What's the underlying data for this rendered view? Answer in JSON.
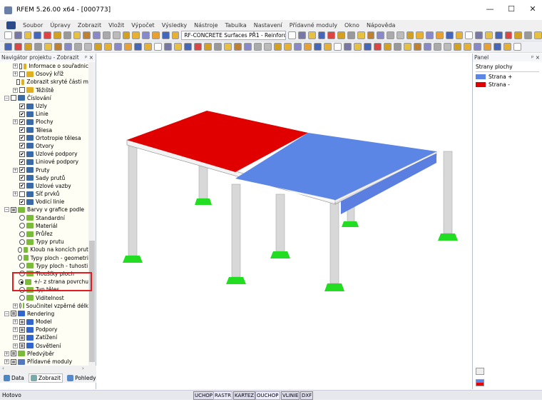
{
  "window": {
    "title": "RFEM 5.26.00 x64 - [000773]",
    "minimize": "—",
    "maximize": "☐",
    "close": "✕"
  },
  "menu": [
    "Soubor",
    "Úpravy",
    "Zobrazit",
    "Vložit",
    "Výpočet",
    "Výsledky",
    "Nástroje",
    "Tabulka",
    "Nastavení",
    "Přídavné moduly",
    "Okno",
    "Nápověda"
  ],
  "toolbar": {
    "case_combo": "RF-CONCRETE Surfaces PŘ1 - Reinforc"
  },
  "navigator": {
    "title": "Navigátor projektu - Zobrazit",
    "pin": "ᵖ ×",
    "items": [
      {
        "label": "Informace o souřadnic",
        "lvl": 2,
        "exp": "+",
        "ctl": "chk",
        "state": "off",
        "icon": "multi"
      },
      {
        "label": "Osový kříž",
        "lvl": 2,
        "exp": "+",
        "ctl": "chk",
        "state": "off",
        "icon": "multi"
      },
      {
        "label": "Zobrazit skryté části m",
        "lvl": 2,
        "exp": "",
        "ctl": "chk",
        "state": "off",
        "icon": "multi"
      },
      {
        "label": "Těžiště",
        "lvl": 2,
        "exp": "+",
        "ctl": "chk",
        "state": "off",
        "icon": "multi"
      },
      {
        "label": "Číslování",
        "lvl": 1,
        "exp": "−",
        "ctl": "chk",
        "state": "off",
        "icon": "num"
      },
      {
        "label": "Uzly",
        "lvl": 2,
        "exp": "",
        "ctl": "chk",
        "state": "on",
        "icon": "num"
      },
      {
        "label": "Linie",
        "lvl": 2,
        "exp": "",
        "ctl": "chk",
        "state": "on",
        "icon": "num"
      },
      {
        "label": "Plochy",
        "lvl": 2,
        "exp": "+",
        "ctl": "chk",
        "state": "on",
        "icon": "num"
      },
      {
        "label": "Tělesa",
        "lvl": 2,
        "exp": "",
        "ctl": "chk",
        "state": "on",
        "icon": "num"
      },
      {
        "label": "Ortotropie tělesa",
        "lvl": 2,
        "exp": "",
        "ctl": "chk",
        "state": "on",
        "icon": "num"
      },
      {
        "label": "Otvory",
        "lvl": 2,
        "exp": "",
        "ctl": "chk",
        "state": "on",
        "icon": "num"
      },
      {
        "label": "Uzlové podpory",
        "lvl": 2,
        "exp": "",
        "ctl": "chk",
        "state": "on",
        "icon": "num"
      },
      {
        "label": "Liniové podpory",
        "lvl": 2,
        "exp": "",
        "ctl": "chk",
        "state": "on",
        "icon": "num"
      },
      {
        "label": "Pruty",
        "lvl": 2,
        "exp": "+",
        "ctl": "chk",
        "state": "on",
        "icon": "num"
      },
      {
        "label": "Sady prutů",
        "lvl": 2,
        "exp": "",
        "ctl": "chk",
        "state": "on",
        "icon": "num"
      },
      {
        "label": "Uzlové vazby",
        "lvl": 2,
        "exp": "",
        "ctl": "chk",
        "state": "on",
        "icon": "num"
      },
      {
        "label": "Síť prvků",
        "lvl": 2,
        "exp": "+",
        "ctl": "chk",
        "state": "off",
        "icon": "num"
      },
      {
        "label": "Vodicí linie",
        "lvl": 2,
        "exp": "",
        "ctl": "chk",
        "state": "on",
        "icon": "num"
      },
      {
        "label": "Barvy v grafice podle",
        "lvl": 1,
        "exp": "−",
        "ctl": "chk",
        "state": "part",
        "icon": "color"
      },
      {
        "label": "Standardní",
        "lvl": 2,
        "exp": "",
        "ctl": "rad",
        "state": "off",
        "icon": "color"
      },
      {
        "label": "Materiál",
        "lvl": 2,
        "exp": "",
        "ctl": "rad",
        "state": "off",
        "icon": "color"
      },
      {
        "label": "Průřez",
        "lvl": 2,
        "exp": "",
        "ctl": "rad",
        "state": "off",
        "icon": "color"
      },
      {
        "label": "Typy prutu",
        "lvl": 2,
        "exp": "",
        "ctl": "rad",
        "state": "off",
        "icon": "color"
      },
      {
        "label": "Kloub na koncích prut",
        "lvl": 2,
        "exp": "",
        "ctl": "rad",
        "state": "off",
        "icon": "color"
      },
      {
        "label": "Typy ploch - geometri",
        "lvl": 2,
        "exp": "",
        "ctl": "rad",
        "state": "off",
        "icon": "color"
      },
      {
        "label": "Typy ploch - tuhosti",
        "lvl": 2,
        "exp": "",
        "ctl": "rad",
        "state": "off",
        "icon": "color"
      },
      {
        "label": "Tloušťky ploch",
        "lvl": 2,
        "exp": "",
        "ctl": "rad",
        "state": "off",
        "icon": "color"
      },
      {
        "label": "+/- z strana povrchu",
        "lvl": 2,
        "exp": "",
        "ctl": "rad",
        "state": "on",
        "icon": "color"
      },
      {
        "label": "Typ těles",
        "lvl": 2,
        "exp": "",
        "ctl": "rad",
        "state": "off",
        "icon": "color"
      },
      {
        "label": "Viditelnost",
        "lvl": 2,
        "exp": "",
        "ctl": "rad",
        "state": "off",
        "icon": "color"
      },
      {
        "label": "Součinitel vzpěrné délk",
        "lvl": 2,
        "exp": "+",
        "ctl": "rad",
        "state": "off",
        "icon": "color"
      },
      {
        "label": "Rendering",
        "lvl": 1,
        "exp": "−",
        "ctl": "chk",
        "state": "part",
        "icon": "render"
      },
      {
        "label": "Model",
        "lvl": 2,
        "exp": "+",
        "ctl": "chk",
        "state": "part",
        "icon": "render"
      },
      {
        "label": "Podpory",
        "lvl": 2,
        "exp": "+",
        "ctl": "chk",
        "state": "part",
        "icon": "render"
      },
      {
        "label": "Zatížení",
        "lvl": 2,
        "exp": "+",
        "ctl": "chk",
        "state": "part",
        "icon": "render"
      },
      {
        "label": "Osvětlení",
        "lvl": 2,
        "exp": "+",
        "ctl": "chk",
        "state": "part",
        "icon": "render"
      },
      {
        "label": "Předvýběr",
        "lvl": 1,
        "exp": "+",
        "ctl": "chk",
        "state": "part",
        "icon": "color"
      },
      {
        "label": "Přídavné moduly",
        "lvl": 1,
        "exp": "+",
        "ctl": "chk",
        "state": "part",
        "icon": "modules"
      }
    ],
    "tabs": [
      "Data",
      "Zobrazit",
      "Pohledy"
    ]
  },
  "panel": {
    "title": "Panel",
    "pin": "ᵖ ×",
    "heading": "Strany plochy",
    "legend": [
      {
        "label": "Strana +",
        "color": "#5b86e5"
      },
      {
        "label": "Strana -",
        "color": "#e00000"
      }
    ]
  },
  "status": {
    "text": "Hotovo",
    "buttons": [
      "UCHOP",
      "RASTR",
      "KARTEZ",
      "OUCHOP",
      "VLINIE",
      "DXF"
    ]
  },
  "colors": {
    "side_plus": "#5b86e5",
    "side_minus": "#e00000",
    "support": "#22dd22",
    "highlight": "#e31b23"
  }
}
